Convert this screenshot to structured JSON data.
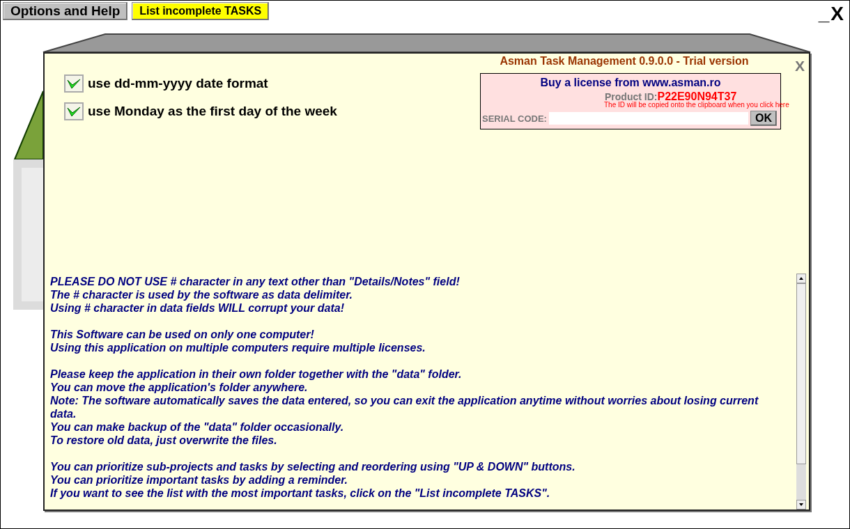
{
  "toolbar": {
    "buttons": [
      {
        "label": "Options and Help",
        "kind": "plain"
      },
      {
        "label": "List incomplete TASKS",
        "kind": "highlight"
      }
    ]
  },
  "window_controls": {
    "minimize": "_",
    "close": "X"
  },
  "dialog": {
    "close": "X",
    "options": [
      {
        "label": "use dd-mm-yyyy date format",
        "checked": true
      },
      {
        "label": "use Monday as the first day of the week",
        "checked": true
      }
    ],
    "title": "Asman Task Management 0.9.0.0 - Trial version",
    "license": {
      "buy_text": "Buy a license from www.asman.ro",
      "product_id_label": "Product ID:",
      "product_id": "P22E90N94T37",
      "copy_note": "The ID will be copied onto the clipboard when you click here",
      "serial_label": "SERIAL CODE:",
      "ok": "OK"
    },
    "help_text": [
      [
        "PLEASE DO NOT USE # character in any text other than \"Details/Notes\" field!",
        "The # character is used by the software as data delimiter.",
        "Using # character in data fields WILL corrupt your data!"
      ],
      [
        "This Software can be used on only one computer!",
        "Using this application on multiple computers require multiple licenses."
      ],
      [
        "Please keep the application in their own folder together with the \"data\" folder.",
        "You can move the application's folder anywhere.",
        "Note: The software automatically saves the data entered, so you can exit the application anytime without worries about losing current data.",
        "You can make backup of the \"data\" folder occasionally.",
        "To restore old data, just overwrite the files."
      ],
      [
        "You can prioritize sub-projects and tasks by selecting and reordering using \"UP & DOWN\" buttons.",
        "You can prioritize important tasks by adding a reminder.",
        "If you want to see the list with the most important tasks, click on the \"List incomplete TASKS\"."
      ]
    ]
  }
}
